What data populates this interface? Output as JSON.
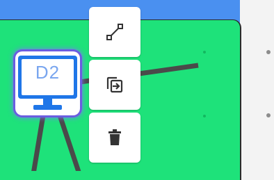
{
  "device": {
    "label": "D2",
    "icon": "monitor-icon"
  },
  "toolbar": {
    "buttons": [
      {
        "name": "edge-button",
        "icon": "connect-line-icon"
      },
      {
        "name": "duplicate-button",
        "icon": "duplicate-icon"
      },
      {
        "name": "delete-button",
        "icon": "trash-icon"
      }
    ]
  },
  "colors": {
    "canvas": "#1ee27a",
    "header": "#4a90f0",
    "node_selection": "#6a5de0",
    "monitor": "#1f76e8",
    "edge": "#4a4a4a"
  }
}
